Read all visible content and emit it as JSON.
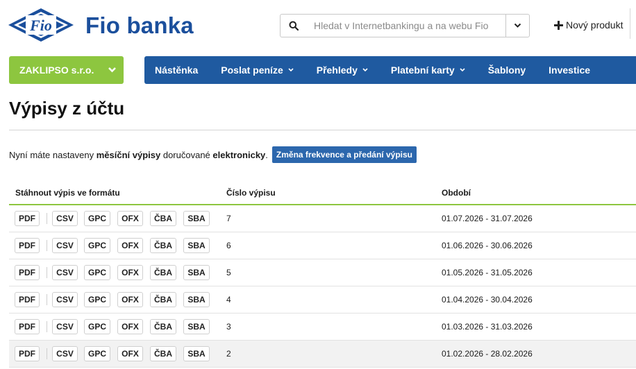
{
  "header": {
    "brand": "Fio banka",
    "logo_text": "Fio",
    "search_placeholder": "Hledat v Internetbankingu a na webu Fio",
    "new_product_label": "Nový produkt"
  },
  "account": {
    "name": "ZAKLIPSO s.r.o."
  },
  "nav": {
    "items": [
      {
        "label": "Nástěnka",
        "has_dropdown": false
      },
      {
        "label": "Poslat peníze",
        "has_dropdown": true
      },
      {
        "label": "Přehledy",
        "has_dropdown": true
      },
      {
        "label": "Platební karty",
        "has_dropdown": true
      },
      {
        "label": "Šablony",
        "has_dropdown": false
      },
      {
        "label": "Investice",
        "has_dropdown": false
      }
    ]
  },
  "page": {
    "title": "Výpisy z účtu",
    "info_prefix": "Nyní máte nastaveny ",
    "info_freq": "měsíční výpisy",
    "info_mid": " doručované ",
    "info_delivery": "elektronicky",
    "info_suffix": ".",
    "change_button": "Změna frekvence a předání výpisu"
  },
  "table": {
    "headers": {
      "download": "Stáhnout výpis ve formátu",
      "number": "Číslo výpisu",
      "period": "Období"
    },
    "formats": [
      "PDF",
      "CSV",
      "GPC",
      "OFX",
      "ČBA",
      "SBA"
    ],
    "rows": [
      {
        "number": "7",
        "period": "01.07.2026 - 31.07.2026"
      },
      {
        "number": "6",
        "period": "01.06.2026 - 30.06.2026"
      },
      {
        "number": "5",
        "period": "01.05.2026 - 31.05.2026"
      },
      {
        "number": "4",
        "period": "01.04.2026 - 30.04.2026"
      },
      {
        "number": "3",
        "period": "01.03.2026 - 31.03.2026"
      },
      {
        "number": "2",
        "period": "01.02.2026 - 28.02.2026"
      }
    ]
  },
  "colors": {
    "brand_blue": "#1b4f9c",
    "nav_blue": "#1f5aa0",
    "accent_green": "#8dc63f",
    "button_blue": "#2c67ad"
  },
  "icons": {
    "search": "search-icon",
    "dropdown": "chevron-down-icon",
    "add": "plus-icon"
  }
}
